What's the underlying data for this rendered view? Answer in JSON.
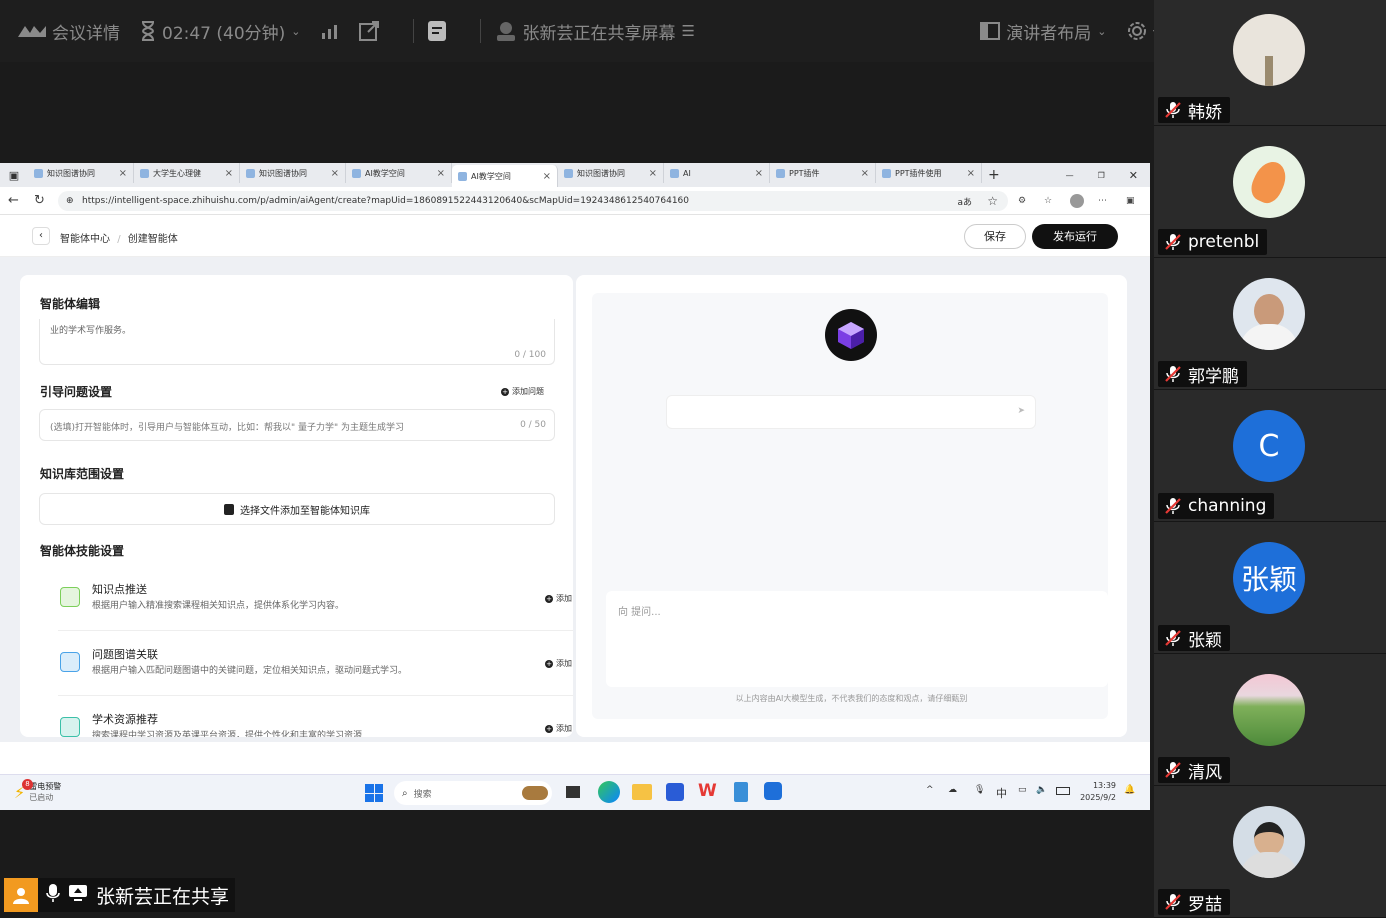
{
  "topbar": {
    "meeting_details": "会议详情",
    "timer": "02:47 (40分钟)",
    "sharing_status": "张新芸正在共享屏幕",
    "layout": "演讲者布局",
    "settings": "设置"
  },
  "browser": {
    "tabs": [
      {
        "label": "知识图谱协同",
        "active": false
      },
      {
        "label": "大学生心理健",
        "active": false
      },
      {
        "label": "知识图谱协同",
        "active": false
      },
      {
        "label": "AI教学空间",
        "active": false
      },
      {
        "label": "AI教学空间",
        "active": true
      },
      {
        "label": "知识图谱协同",
        "active": false
      },
      {
        "label": "AI",
        "active": false
      },
      {
        "label": "PPT插件",
        "active": false
      },
      {
        "label": "PPT插件使用",
        "active": false
      }
    ],
    "url": "https://intelligent-space.zhihuishu.com/p/admin/aiAgent/create?mapUid=1860891522443120640&scMapUid=1924348612540764160"
  },
  "app": {
    "breadcrumb_home": "智能体中心",
    "breadcrumb_sep": "/",
    "breadcrumb_current": "创建智能体",
    "save": "保存",
    "publish": "发布运行",
    "editor_title": "智能体编辑",
    "desc_text": "业的学术写作服务。",
    "desc_count": "0 / 100",
    "guide_title": "引导问题设置",
    "add_question": "添加问题",
    "guide_placeholder": "(选填)打开智能体时，引导用户与智能体互动，比如：帮我以\" 量子力学\" 为主题生成学习",
    "guide_count": "0 / 50",
    "kb_title": "知识库范围设置",
    "kb_select": "选择文件添加至智能体知识库",
    "skills_title": "智能体技能设置",
    "add_label": "添加",
    "skills": [
      {
        "name": "知识点推送",
        "desc": "根据用户输入精准搜索课程相关知识点，提供体系化学习内容。",
        "color": "#7ccf5a"
      },
      {
        "name": "问题图谱关联",
        "desc": "根据用户输入匹配问题图谱中的关键问题，定位相关知识点，驱动问题式学习。",
        "color": "#4aa3e8"
      },
      {
        "name": "学术资源推荐",
        "desc": "搜索课程中学习资源及英课平台资源，提供个性化和丰富的学习资源",
        "color": "#3cc0a8"
      }
    ],
    "ask_placeholder": "向 提问...",
    "disclaimer": "以上内容由AI大模型生成，不代表我们的态度和观点，请仔细甄别"
  },
  "taskbar": {
    "weather_title": "雷电预警",
    "weather_sub": "已启动",
    "weather_badge": "8",
    "search": "搜索",
    "ime": "中",
    "time": "13:39",
    "date": "2025/9/2"
  },
  "participants": [
    {
      "name": "韩娇",
      "avatar": "photo-flower"
    },
    {
      "name": "pretenbl",
      "avatar": "photo-carrot"
    },
    {
      "name": "郭学鹏",
      "avatar": "photo-man"
    },
    {
      "name": "channing",
      "avatar": "letter",
      "letter": "C"
    },
    {
      "name": "张颖",
      "avatar": "letter",
      "letter": "张颖"
    },
    {
      "name": "清风",
      "avatar": "photo-landscape"
    },
    {
      "name": "罗喆",
      "avatar": "photo-person"
    }
  ],
  "share_badge": "张新芸正在共享"
}
